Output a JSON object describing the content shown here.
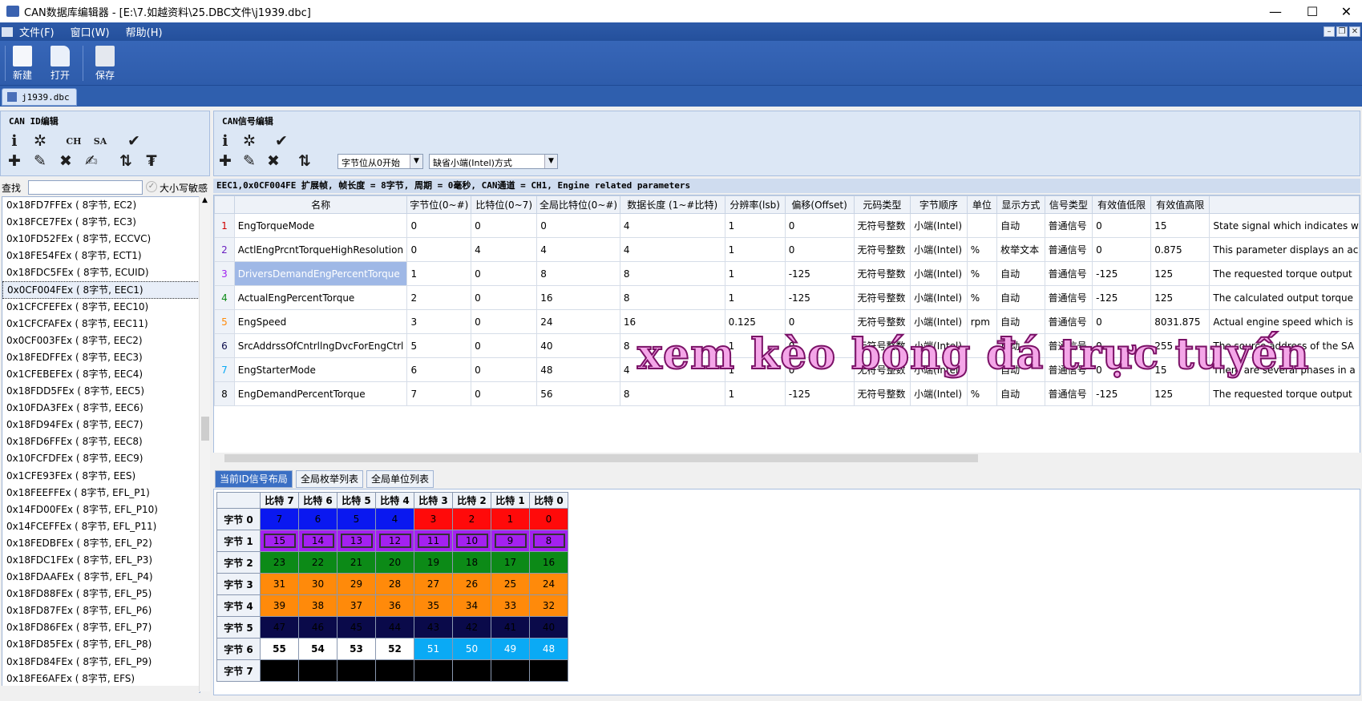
{
  "window": {
    "title": "CAN数据库编辑器 - [E:\\7.如越资料\\25.DBC文件\\j1939.dbc]",
    "minimize": "—",
    "maximize": "☐",
    "close": "✕"
  },
  "menu": [
    "文件(F)",
    "窗口(W)",
    "帮助(H)"
  ],
  "mdi": {
    "min": "–",
    "restore": "❐",
    "close": "✕"
  },
  "ribbon": {
    "new": "新建",
    "open": "打开",
    "save": "保存"
  },
  "doc_tab": "j1939.dbc",
  "can_id_panel": {
    "title": "CAN ID编辑",
    "ch": "CH",
    "sa": "SA"
  },
  "signal_panel": {
    "title": "CAN信号编辑",
    "byte_order_dropdown": "字节位从0开始",
    "endian_dropdown": "缺省小端(Intel)方式"
  },
  "search": {
    "label": "查找",
    "value": "",
    "case_label": "大小写敏感"
  },
  "id_list": [
    "0x18FD7FFEx ( 8字节, EC2)",
    "0x18FCE7FEx ( 8字节, EC3)",
    "0x10FD52FEx ( 8字节, ECCVC)",
    "0x18FE54FEx ( 8字节, ECT1)",
    "0x18FDC5FEx ( 8字节, ECUID)",
    "0x0CF004FEx ( 8字节, EEC1)",
    "0x1CFCFEFEx ( 8字节, EEC10)",
    "0x1CFCFAFEx ( 8字节, EEC11)",
    "0x0CF003FEx ( 8字节, EEC2)",
    "0x18FEDFFEx ( 8字节, EEC3)",
    "0x1CFEBEFEx ( 8字节, EEC4)",
    "0x18FDD5FEx ( 8字节, EEC5)",
    "0x10FDA3FEx ( 8字节, EEC6)",
    "0x18FD94FEx ( 8字节, EEC7)",
    "0x18FD6FFEx ( 8字节, EEC8)",
    "0x10FCFDFEx ( 8字节, EEC9)",
    "0x1CFE93FEx ( 8字节, EES)",
    "0x18FEEFFEx ( 8字节, EFL_P1)",
    "0x14FD00FEx ( 8字节, EFL_P10)",
    "0x14FCEFFEx ( 8字节, EFL_P11)",
    "0x18FEDBFEx ( 8字节, EFL_P2)",
    "0x18FDC1FEx ( 8字节, EFL_P3)",
    "0x18FDAAFEx ( 8字节, EFL_P4)",
    "0x18FD88FEx ( 8字节, EFL_P5)",
    "0x18FD87FEx ( 8字节, EFL_P6)",
    "0x18FD86FEx ( 8字节, EFL_P7)",
    "0x18FD85FEx ( 8字节, EFL_P8)",
    "0x18FD84FEx ( 8字节, EFL_P9)",
    "0x18FE6AFEx ( 8字节, EFS)"
  ],
  "selected_index": 5,
  "info_bar": "EEC1,0x0CF004FE 扩展帧, 帧长度 = 8字节, 周期 = 0毫秒, CAN通道 = CH1, Engine related parameters",
  "columns": [
    "名称",
    "字节位(0~#)",
    "比特位(0~7)",
    "全局比特位(0~#)",
    "数据长度 (1~#比特)",
    "分辨率(lsb)",
    "偏移(Offset)",
    "元码类型",
    "字节顺序",
    "单位",
    "显示方式",
    "信号类型",
    "有效值低限",
    "有效值高限",
    ""
  ],
  "signals": [
    {
      "n": "1",
      "name": "EngTorqueMode",
      "byte": "0",
      "bit": "0",
      "gbit": "0",
      "len": "4",
      "res": "1",
      "off": "0",
      "enc": "无符号整数",
      "order": "小端(Intel)",
      "unit": "",
      "disp": "自动",
      "type": "普通信号",
      "min": "0",
      "max": "15",
      "desc": "State signal which indicates w",
      "color": "#d00000"
    },
    {
      "n": "2",
      "name": "ActlEngPrcntTorqueHighResolution",
      "byte": "0",
      "bit": "4",
      "gbit": "4",
      "len": "4",
      "res": "1",
      "off": "0",
      "enc": "无符号整数",
      "order": "小端(Intel)",
      "unit": "%",
      "disp": "枚举文本",
      "type": "普通信号",
      "min": "0",
      "max": "0.875",
      "desc": "This parameter displays an ac",
      "color": "#6a20c0"
    },
    {
      "n": "3",
      "name": "DriversDemandEngPercentTorque",
      "byte": "1",
      "bit": "0",
      "gbit": "8",
      "len": "8",
      "res": "1",
      "off": "-125",
      "enc": "无符号整数",
      "order": "小端(Intel)",
      "unit": "%",
      "disp": "自动",
      "type": "普通信号",
      "min": "-125",
      "max": "125",
      "desc": "The requested torque output",
      "color": "#a020f0"
    },
    {
      "n": "4",
      "name": "ActualEngPercentTorque",
      "byte": "2",
      "bit": "0",
      "gbit": "16",
      "len": "8",
      "res": "1",
      "off": "-125",
      "enc": "无符号整数",
      "order": "小端(Intel)",
      "unit": "%",
      "disp": "自动",
      "type": "普通信号",
      "min": "-125",
      "max": "125",
      "desc": "The calculated output torque",
      "color": "#0c8a17"
    },
    {
      "n": "5",
      "name": "EngSpeed",
      "byte": "3",
      "bit": "0",
      "gbit": "24",
      "len": "16",
      "res": "0.125",
      "off": "0",
      "enc": "无符号整数",
      "order": "小端(Intel)",
      "unit": "rpm",
      "disp": "自动",
      "type": "普通信号",
      "min": "0",
      "max": "8031.875",
      "desc": "Actual engine speed which is",
      "color": "#ff8a0a"
    },
    {
      "n": "6",
      "name": "SrcAddrssOfCntrllngDvcForEngCtrl",
      "byte": "5",
      "bit": "0",
      "gbit": "40",
      "len": "8",
      "res": "1",
      "off": "0",
      "enc": "无符号整数",
      "order": "小端(Intel)",
      "unit": "",
      "disp": "自动",
      "type": "普通信号",
      "min": "0",
      "max": "255",
      "desc": "The source address of the SA",
      "color": "#0a0a4a"
    },
    {
      "n": "7",
      "name": "EngStarterMode",
      "byte": "6",
      "bit": "0",
      "gbit": "48",
      "len": "4",
      "res": "1",
      "off": "0",
      "enc": "无符号整数",
      "order": "小端(Intel)",
      "unit": "",
      "disp": "自动",
      "type": "普通信号",
      "min": "0",
      "max": "15",
      "desc": "There are several phases in a",
      "color": "#0aaaf5"
    },
    {
      "n": "8",
      "name": "EngDemandPercentTorque",
      "byte": "7",
      "bit": "0",
      "gbit": "56",
      "len": "8",
      "res": "1",
      "off": "-125",
      "enc": "无符号整数",
      "order": "小端(Intel)",
      "unit": "%",
      "disp": "自动",
      "type": "普通信号",
      "min": "-125",
      "max": "125",
      "desc": "The requested torque output",
      "color": "#000000"
    }
  ],
  "bottom_tabs": [
    "当前ID信号布局",
    "全局枚举列表",
    "全局单位列表"
  ],
  "bit_header": [
    "比特 7",
    "比特 6",
    "比特 5",
    "比特 4",
    "比特 3",
    "比特 2",
    "比特 1",
    "比特 0"
  ],
  "bit_rows": [
    {
      "label": "字节 0",
      "cells": [
        "7",
        "6",
        "5",
        "4",
        "3",
        "2",
        "1",
        "0"
      ],
      "cls": [
        "c-blue",
        "c-blue",
        "c-blue",
        "c-blue",
        "c-red",
        "c-red",
        "c-red",
        "c-red"
      ]
    },
    {
      "label": "字节 1",
      "cells": [
        "15",
        "14",
        "13",
        "12",
        "11",
        "10",
        "9",
        "8"
      ],
      "cls": [
        "c-purple",
        "c-purple",
        "c-purple",
        "c-purple",
        "c-purple",
        "c-purple",
        "c-purple",
        "c-purple"
      ]
    },
    {
      "label": "字节 2",
      "cells": [
        "23",
        "22",
        "21",
        "20",
        "19",
        "18",
        "17",
        "16"
      ],
      "cls": [
        "c-green",
        "c-green",
        "c-green",
        "c-green",
        "c-green",
        "c-green",
        "c-green",
        "c-green"
      ]
    },
    {
      "label": "字节 3",
      "cells": [
        "31",
        "30",
        "29",
        "28",
        "27",
        "26",
        "25",
        "24"
      ],
      "cls": [
        "c-orange",
        "c-orange",
        "c-orange",
        "c-orange",
        "c-orange",
        "c-orange",
        "c-orange",
        "c-orange"
      ]
    },
    {
      "label": "字节 4",
      "cells": [
        "39",
        "38",
        "37",
        "36",
        "35",
        "34",
        "33",
        "32"
      ],
      "cls": [
        "c-orange",
        "c-orange",
        "c-orange",
        "c-orange",
        "c-orange",
        "c-orange",
        "c-orange",
        "c-orange"
      ]
    },
    {
      "label": "字节 5",
      "cells": [
        "47",
        "46",
        "45",
        "44",
        "43",
        "42",
        "41",
        "40"
      ],
      "cls": [
        "c-navy",
        "c-navy",
        "c-navy",
        "c-navy",
        "c-navy",
        "c-navy",
        "c-navy",
        "c-navy"
      ]
    },
    {
      "label": "字节 6",
      "cells": [
        "55",
        "54",
        "53",
        "52",
        "51",
        "50",
        "49",
        "48"
      ],
      "cls": [
        "c-white",
        "c-white",
        "c-white",
        "c-white",
        "c-cyan",
        "c-cyan",
        "c-cyan",
        "c-cyan"
      ]
    },
    {
      "label": "字节 7",
      "cells": [
        "",
        "",
        "",
        "",
        "",
        "",
        "",
        ""
      ],
      "cls": [
        "c-black",
        "c-black",
        "c-black",
        "c-black",
        "c-black",
        "c-black",
        "c-black",
        "c-black"
      ]
    }
  ],
  "watermark": "xem kèo bóng đá trực tuyến"
}
